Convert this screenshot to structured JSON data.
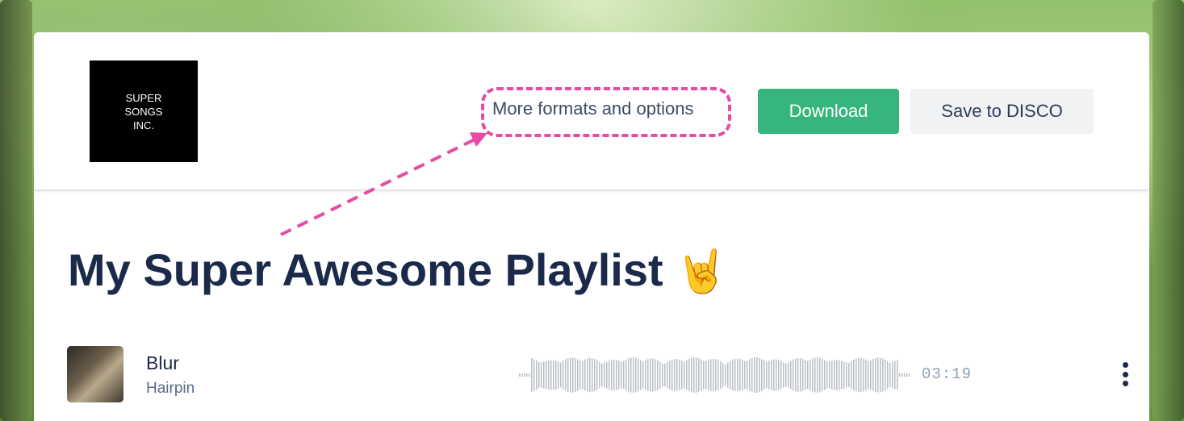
{
  "header": {
    "logo_text": "SUPER\nSONGS\nINC.",
    "more_formats_label": "More formats and options",
    "download_label": "Download",
    "save_label": "Save to DISCO"
  },
  "playlist": {
    "title": "My Super Awesome Playlist",
    "title_emoji": "🤘"
  },
  "tracks": [
    {
      "title": "Blur",
      "artist": "Hairpin",
      "duration": "03:19"
    }
  ],
  "colors": {
    "brand_green": "#36b57c",
    "annotation_pink": "#e84aa5",
    "title_navy": "#1b2a4a"
  },
  "icons": {
    "menu": "vertical-ellipsis"
  }
}
